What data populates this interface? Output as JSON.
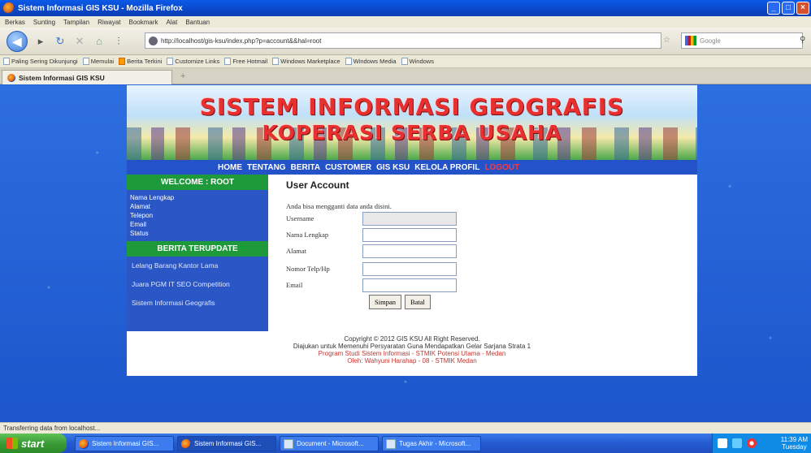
{
  "window": {
    "title": "Sistem Informasi GIS KSU - Mozilla Firefox"
  },
  "menubar": [
    "Berkas",
    "Sunting",
    "Tampilan",
    "Riwayat",
    "Bookmark",
    "Alat",
    "Bantuan"
  ],
  "navbar": {
    "url": "http://localhost/gis-ksu/index.php?p=account&&hal=root",
    "search_placeholder": "Google"
  },
  "bookmarks": [
    "Paling Sering Dikunjungi",
    "Memulai",
    "Berita Terkini",
    "Customize Links",
    "Free Hotmail",
    "Windows Marketplace",
    "Windows Media",
    "Windows"
  ],
  "tab": {
    "label": "Sistem Informasi GIS KSU"
  },
  "site": {
    "title_line1": "SISTEM INFORMASI GEOGRAFIS",
    "title_line2": "KOPERASI SERBA USAHA",
    "nav": [
      "HOME",
      "TENTANG",
      "BERITA",
      "CUSTOMER",
      "GIS KSU",
      "KELOLA PROFIL",
      "LOGOUT"
    ],
    "welcome": "WELCOME : ROOT",
    "profile_list": [
      "Nama Lengkap",
      "Alamat",
      "Telepon",
      "Email",
      "Status"
    ],
    "news_head": "BERITA TERUPDATE",
    "news": [
      "Lelang Barang Kantor Lama",
      "Juara PGM IT SEO Competition",
      "Sistem Informasi Geografis"
    ],
    "main_title": "User Account",
    "main_subtitle": "Anda bisa mengganti data anda disini.",
    "form": {
      "username_label": "Username",
      "nama_label": "Nama Lengkap",
      "alamat_label": "Alamat",
      "telp_label": "Nomor Telp/Hp",
      "email_label": "Email",
      "save_label": "Simpan",
      "reset_label": "Batal"
    },
    "footer": {
      "line1": "Copyright © 2012 GIS KSU All Right Reserved.",
      "line2": "Diajukan untuk Memenuhi Persyaratan Guna Mendapatkan Gelar Sarjana Strata 1",
      "line3": "Program Studi Sistem Informasi - STMIK Potensi Utama - Medan",
      "line4": "Oleh: Wahyuni Harahap - 08 - STMIK Medan"
    }
  },
  "status": "Transferring data from localhost...",
  "taskbar": {
    "start": "start",
    "items": [
      "Sistem Informasi GIS...",
      "Sistem Informasi GIS...",
      "Document - Microsoft...",
      "Tugas Akhir - Microsoft..."
    ],
    "clock_time": "11:39 AM",
    "clock_day": "Tuesday"
  },
  "colors": {
    "site_blue": "#2452c8",
    "sidebar_green": "#1f9a3a",
    "title_red": "#e83030",
    "logout_red": "#ff3a3a"
  }
}
